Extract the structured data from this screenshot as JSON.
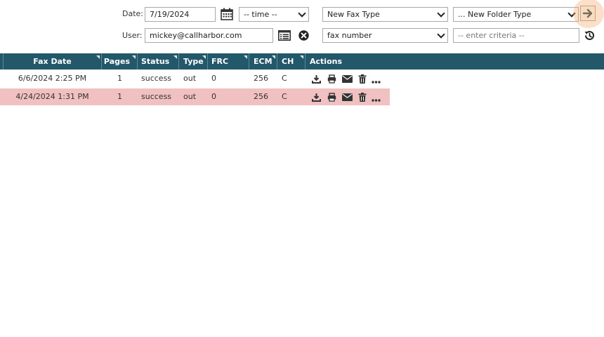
{
  "filters": {
    "date_label": "Date:",
    "date_value": "7/19/2024",
    "time_value": "-- time --",
    "user_label": "User:",
    "user_value": "mickey@callharbor.com",
    "fax_type_value": "New Fax Type",
    "folder_type_value": "... New Folder Type",
    "search_field_value": "fax number",
    "criteria_placeholder": "-- enter criteria --"
  },
  "table": {
    "columns": [
      "Fax Date",
      "Pages",
      "Status",
      "Type",
      "FRC",
      "ECM",
      "CH",
      "Actions"
    ],
    "rows": [
      {
        "fax_date": "6/6/2024 2:25 PM",
        "pages": "1",
        "status": "success",
        "type": "out",
        "frc": "0",
        "ecm": "256",
        "ch": "C"
      },
      {
        "fax_date": "4/24/2024 1:31 PM",
        "pages": "1",
        "status": "success",
        "type": "out",
        "frc": "0",
        "ecm": "256",
        "ch": "C"
      }
    ],
    "row_highlight_color": "#f1c0c0",
    "header_color": "#23586b"
  },
  "icons": {
    "calendar": "calendar-icon",
    "list": "list-icon",
    "clear": "close-circle-icon",
    "go": "arrow-right-icon",
    "reset": "history-icon",
    "download": "download-icon",
    "print": "print-icon",
    "email": "envelope-icon",
    "delete": "trash-icon",
    "more": "ellipsis-icon"
  }
}
